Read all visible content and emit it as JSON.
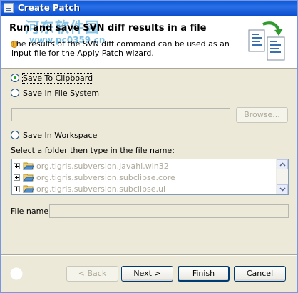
{
  "window": {
    "title": "Create Patch"
  },
  "banner": {
    "heading": "Run and save SVN diff results in a file",
    "description": "The results of the SVN diff command can be used as an input file for the Apply Patch wizard.",
    "watermark": "河东软件园",
    "watermark_url": "www.pc0359.cn"
  },
  "options": {
    "clipboard_label": "Save To Clipboard",
    "filesystem_label": "Save In File System",
    "workspace_label": "Save In Workspace",
    "selected": "clipboard"
  },
  "filesystem": {
    "path_value": "",
    "browse_label": "Browse..."
  },
  "workspace": {
    "folder_prompt": "Select a folder then type in the file name:",
    "folders": [
      "org.tigris.subversion.javahl.win32",
      "org.tigris.subversion.subclipse.core",
      "org.tigris.subversion.subclipse.ui"
    ],
    "file_name_label": "File name:",
    "file_name_value": ""
  },
  "footer": {
    "help_icon": "question-mark-icon",
    "back_label": "< Back",
    "next_label": "Next >",
    "finish_label": "Finish",
    "cancel_label": "Cancel"
  },
  "colors": {
    "title_bar": "#0a58d8",
    "dialog_bg": "#ece9d8",
    "radio_dot": "#21a121",
    "disabled_text": "#aca899"
  }
}
